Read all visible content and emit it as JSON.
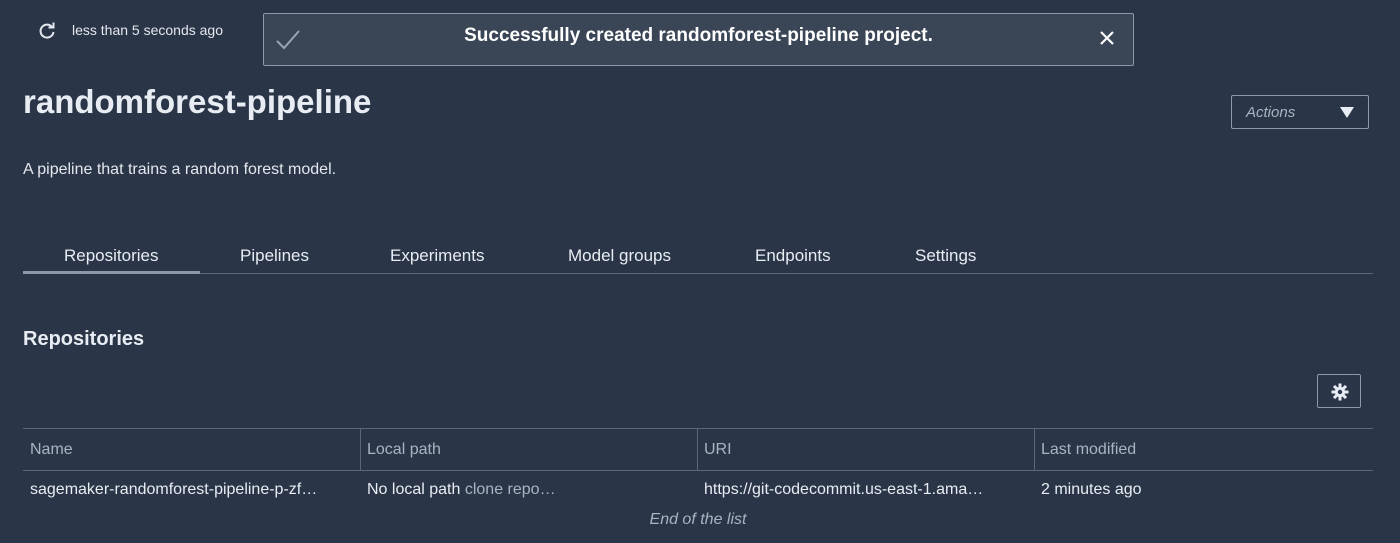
{
  "refresh": {
    "icon": "refresh-icon",
    "last_updated": "less than 5 seconds ago"
  },
  "flash": {
    "icon": "checkmark-icon",
    "message": "Successfully created randomforest-pipeline project.",
    "close_icon": "close-icon"
  },
  "project": {
    "title": "randomforest-pipeline",
    "description": "A pipeline that trains a random forest model.",
    "actions_label": "Actions",
    "actions_icon": "caret-down-icon"
  },
  "tabs": [
    {
      "label": "Repositories",
      "selected": true
    },
    {
      "label": "Pipelines",
      "selected": false
    },
    {
      "label": "Experiments",
      "selected": false
    },
    {
      "label": "Model groups",
      "selected": false
    },
    {
      "label": "Endpoints",
      "selected": false
    },
    {
      "label": "Settings",
      "selected": false
    }
  ],
  "repositories": {
    "section_title": "Repositories",
    "settings_icon": "gear-icon",
    "columns": [
      "Name",
      "Local path",
      "URI",
      "Last modified"
    ],
    "rows": [
      {
        "name": "sagemaker-randomforest-pipeline-p-zf…",
        "local_path": "No local path",
        "clone_link": "clone repo…",
        "uri": "https://git-codecommit.us-east-1.ama…",
        "last_modified": "2 minutes ago"
      }
    ],
    "end_text": "End of the list"
  },
  "colors": {
    "background": "#2a3547",
    "flash_background": "#3a4556",
    "border": "#8d99a8",
    "text": "#e4e8ee",
    "muted_text": "#aab4c0"
  }
}
